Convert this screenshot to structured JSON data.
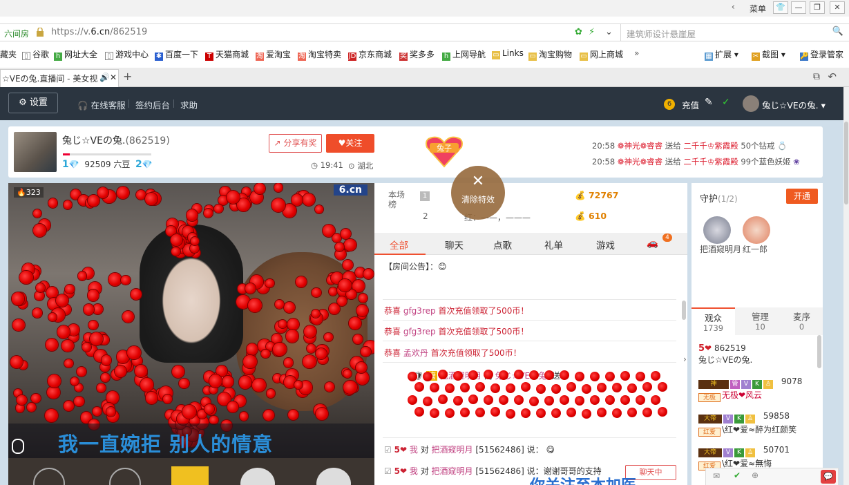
{
  "browser": {
    "menu_label": "菜单",
    "site_label": "六间房",
    "url_prefix": "https://v.",
    "url_domain": "6.cn",
    "url_path": "/862519",
    "search_placeholder": "建筑师设计悬崖屋",
    "bookmarks": [
      "藏夹",
      "谷歌",
      "网址大全",
      "游戏中心",
      "百度一下",
      "天猫商城",
      "爱淘宝",
      "淘宝特卖",
      "京东商城",
      "奖多多",
      "上网导航",
      "Links",
      "淘宝购物",
      "网上商城"
    ],
    "toolbar_right": [
      "扩展",
      "截图",
      "登录管家"
    ],
    "tab_title": "☆VEの兔.直播间 - 美女视"
  },
  "nav": {
    "settings": "设置",
    "links": [
      "在线客服",
      "签约后台",
      "求助"
    ],
    "coin_badge": "6",
    "recharge": "充值",
    "user": "兔じ☆VEの兔."
  },
  "anchor": {
    "name": "兔じ☆VEの兔.",
    "room_id": "(862519)",
    "level1": "1",
    "coins": "92509 六豆",
    "level2": "2",
    "share": "分享有奖",
    "follow": "关注",
    "time": "19:41",
    "location": "湖北",
    "badge_label": "兔子",
    "gifts": [
      {
        "time": "20:58",
        "sender": "❁神光❁睿睿",
        "verb": "送给",
        "receiver": "二千千♔紫霞殿",
        "item": "50个钻戒"
      },
      {
        "time": "20:58",
        "sender": "❁神光❁睿睿",
        "verb": "送给",
        "receiver": "二千千♔紫霞殿",
        "item": "99个蓝色妖姬"
      }
    ]
  },
  "video": {
    "viewer_count": "323",
    "logo": "6.cn",
    "lyric": "我一直婉拒  别人的情意"
  },
  "chat": {
    "rank_label": "本场榜",
    "rank_amounts": [
      "72767",
      "610"
    ],
    "rank_second": "2",
    "rank_second_name": "红：——，———",
    "clear_fx": "清除特效",
    "tabs": [
      "全部",
      "聊天",
      "点歌",
      "礼单",
      "游戏"
    ],
    "car_count": "4",
    "notice_label": "【房间公告】：",
    "messages": [
      {
        "prefix": "恭喜",
        "user": "gfg3rep",
        "text": "首次充值领取了500币！"
      },
      {
        "prefix": "恭喜",
        "user": "gfg3rep",
        "text": "首次充值领取了500币！"
      },
      {
        "prefix": "恭喜",
        "user": "孟欢丹",
        "text": "首次充值领取了500币！"
      }
    ],
    "gift_line": {
      "user": "把酒窥明月",
      "verb": "向",
      "target": "兔じ☆VEの兔.",
      "action": "送"
    },
    "speech_lines": [
      {
        "lvl": "5",
        "who": "我",
        "to": "对",
        "target": "把酒窥明月",
        "id": "[51562486]",
        "said": "说："
      },
      {
        "lvl": "5",
        "who": "我",
        "to": "对",
        "target": "把酒窥明月",
        "id": "[51562486]",
        "said": "说：谢谢哥哥的支持"
      }
    ],
    "private_btn": "聊天中",
    "banner_text": "你关注至本加医"
  },
  "side": {
    "guard_title": "守护",
    "guard_count": "(1/2)",
    "open_btn": "开通",
    "guards": [
      "把酒窥明月",
      "红一郎"
    ],
    "viewer_tabs": [
      {
        "label": "观众",
        "count": "1739"
      },
      {
        "label": "管理",
        "count": "10"
      },
      {
        "label": "麦序",
        "count": "0"
      }
    ],
    "viewers": [
      {
        "lvl": "5",
        "id": "862519",
        "name": "兔じ☆VEの兔."
      },
      {
        "lvl": "",
        "id": "9078",
        "name": "无极❤风云",
        "tag": "无极"
      },
      {
        "lvl": "",
        "id": "59858",
        "name": "\\红❤爱≈醉为红颜笑",
        "tag": "红爱"
      },
      {
        "lvl": "",
        "id": "50701",
        "name": "\\红❤爱≈無悔",
        "tag": "红爱"
      }
    ]
  },
  "colors": {
    "accent": "#ef5030",
    "nav_bg": "#2b3540",
    "page_bg": "#cfdeea",
    "rose": "#e00000"
  }
}
